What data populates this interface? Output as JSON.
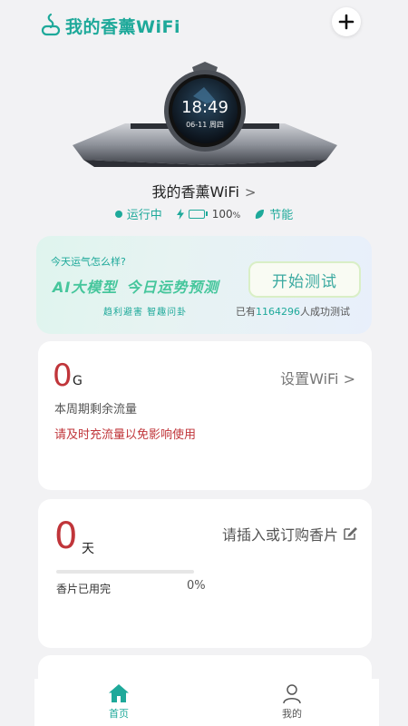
{
  "header": {
    "title": "我的香薰WiFi",
    "logo_icon": "aroma-logo-icon",
    "add_icon": "plus-icon"
  },
  "device": {
    "screen_time": "18:49",
    "screen_date": "06-11 周四",
    "name": "我的香薰WiFi",
    "name_chevron": ">",
    "status_running": "运行中",
    "battery_percent": "100",
    "battery_percent_unit": "%",
    "battery_level": 1.0,
    "eco_label": "节能"
  },
  "ai_banner": {
    "question": "今天运气怎么样?",
    "headline_part1": "AI大模型",
    "headline_part2": "今日运势预测",
    "subline": "趋利避害 智趣问卦",
    "button_label": "开始测试",
    "count_prefix": "已有",
    "count_value": "1164296",
    "count_suffix": "人成功测试"
  },
  "traffic_card": {
    "value": "0",
    "unit": "G",
    "link_label": "设置WiFi >",
    "description": "本周期剩余流量",
    "warning": "请及时充流量以免影响使用"
  },
  "aroma_card": {
    "value": "0",
    "unit": "天",
    "link_label": "请插入或订购香片",
    "edit_icon": "edit-icon",
    "status_label": "香片已用完",
    "percent_label": "0%",
    "progress": 0
  },
  "tabbar": {
    "home_label": "首页",
    "mine_label": "我的"
  },
  "colors": {
    "accent": "#1ea99a",
    "alert": "#c0353a",
    "background": "#f2f2f4"
  }
}
